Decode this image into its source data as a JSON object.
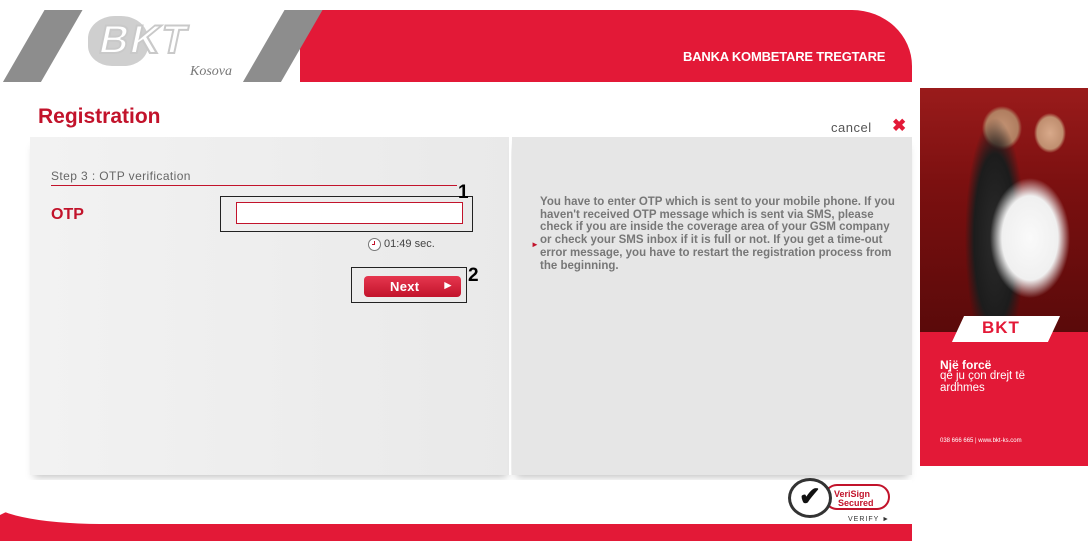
{
  "header": {
    "logo_text": "BKT",
    "logo_subtitle": "Kosova",
    "bank_name": "BANKA KOMBETARE TREGTARE"
  },
  "page": {
    "title": "Registration",
    "cancel_label": "cancel",
    "cancel_icon": "✖"
  },
  "form": {
    "step_label": "Step 3 : OTP verification",
    "otp_label": "OTP",
    "otp_value": "",
    "otp_placeholder": "",
    "timer": "01:49 sec.",
    "next_label": "Next",
    "next_arrow": "►",
    "marker_1": "1",
    "marker_2": "2"
  },
  "help": {
    "text": "You have to enter OTP which is sent to your mobile phone. If you haven't received OTP message which is sent via SMS, please check if you are inside the coverage area of your GSM company or check your SMS inbox if it is full or not. If you get a time-out error message, you have to restart the registration process from the beginning.",
    "bullet": "►"
  },
  "footer": {
    "badge_line1": "VeriSign",
    "badge_line2": "Secured",
    "badge_verify": "VERIFY ►",
    "badge_check": "✔"
  },
  "ad": {
    "logo_text": "BKT",
    "line1": "Një forcë",
    "line2": "që ju çon drejt të",
    "line3": "ardhmes",
    "contact": "038 666 665 | www.bkt-ks.com"
  },
  "colors": {
    "brand_red": "#e31937",
    "title_red": "#c2132b",
    "panel_gray": "#e9e9e9"
  },
  "icons": {
    "cancel": "close-icon",
    "timer": "clock-icon",
    "next": "arrow-right-icon",
    "verisign": "checkmark-icon"
  }
}
